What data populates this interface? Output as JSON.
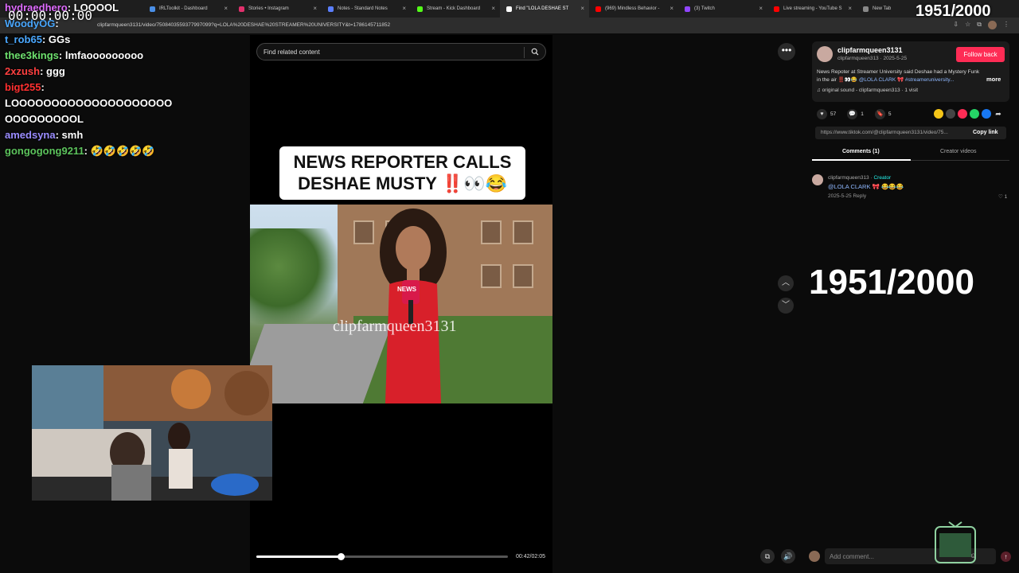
{
  "browser": {
    "tabs": [
      {
        "label": "IRLToolkit - Dashboard",
        "color": "#4a8fe7",
        "active": false
      },
      {
        "label": "Stories • Instagram",
        "color": "#e1306c",
        "active": false
      },
      {
        "label": "Notes - Standard Notes",
        "color": "#5b7fff",
        "active": false
      },
      {
        "label": "Stream - Kick Dashboard",
        "color": "#53fc18",
        "active": false
      },
      {
        "label": "Find \"LOLA DESHAE ST",
        "color": "#ffffff",
        "active": true
      },
      {
        "label": "(969) Mindless Behavior -",
        "color": "#ff0000",
        "active": false
      },
      {
        "label": "(3) Twitch",
        "color": "#9146ff",
        "active": false
      },
      {
        "label": "Live streaming - YouTube S",
        "color": "#ff0000",
        "active": false
      },
      {
        "label": "New Tab",
        "color": "#888888",
        "active": false
      }
    ],
    "url": "clipfarmqueen3131/video/7508403559377997099?q=LOLA%20DESHAE%20STREAMER%20UNIVERSITY&t=1786145711852"
  },
  "overlay": {
    "timer": "00:00:00:00",
    "counter_top": "1951/2000",
    "counter_big": "1951/2000"
  },
  "chat": [
    {
      "user": "hydraedhero",
      "msg": "LOOOOL",
      "color": "#e06cff"
    },
    {
      "user": "WoodyOG",
      "msg": "",
      "color": "#4aa8ff"
    },
    {
      "user": "t_rob65",
      "msg": "GGs",
      "color": "#4aa8ff"
    },
    {
      "user": "thee3kings",
      "msg": "lmfaooooooooo",
      "color": "#6ee06e"
    },
    {
      "user": "2xzush",
      "msg": "ggg",
      "color": "#ff4040"
    },
    {
      "user": "bigt255",
      "msg": "",
      "color": "#ff3030"
    },
    {
      "user": "",
      "msg": "LOOOOOOOOOOOOOOOOOOOO",
      "color": "#ffffff"
    },
    {
      "user": "",
      "msg": "OOOOOOOOOL",
      "color": "#ffffff"
    },
    {
      "user": "amedsyna",
      "msg": "smh",
      "color": "#9a8cff"
    },
    {
      "user": "gongogong9211",
      "msg": "🤣🤣🤣🤣🤣",
      "color": "#5cc35c"
    }
  ],
  "player": {
    "search_placeholder": "Find related content",
    "headline_line1": "NEWS REPORTER CALLS",
    "headline_line2": "DESHAE MUSTY ‼️👀😂",
    "watermark": "clipfarmqueen3131",
    "mic_label": "NEWS",
    "timecode": "00:42/02:05",
    "progress": 0.336
  },
  "post": {
    "username": "clipfarmqueen3131",
    "handle_date": "clipfarmqueen313 · 2025-5-25",
    "follow_label": "Follow back",
    "description": "News Repoter at Streamer University said Deshae had a Mystery Funk in the air ‼️👀😂 ",
    "description_tags": "@LOLA CLARK 🎀 #streameruniversity...",
    "more_label": "more",
    "sound": "♫  original sound - clipfarmqueen313 · 1 visit",
    "likes": "57",
    "comments": "1",
    "saves": "5",
    "link": "https://www.tiktok.com/@clipfarmqueen3131/video/75...",
    "copy_label": "Copy link",
    "tab_comments": "Comments (1)",
    "tab_creator": "Creator videos"
  },
  "comment": {
    "author": "clipfarmqueen313",
    "creator_tag": "Creator",
    "mention": "@LOLA CLARK 🎀",
    "text": " 😂😂😂",
    "date": "2025-5-25",
    "reply_label": "Reply",
    "likes": "♡ 1"
  },
  "comment_box": {
    "placeholder": "Add comment..."
  }
}
